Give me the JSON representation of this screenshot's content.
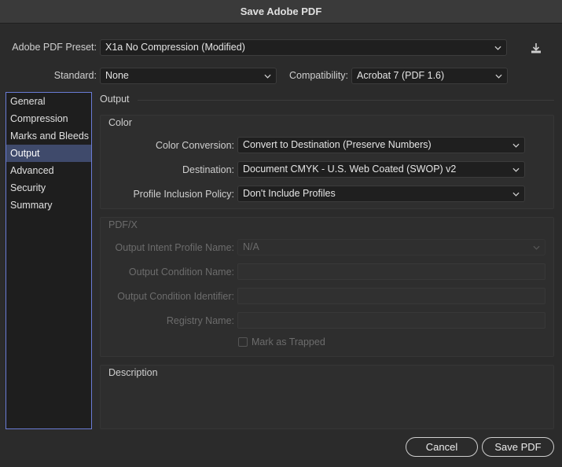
{
  "window": {
    "title": "Save Adobe PDF"
  },
  "preset": {
    "label": "Adobe PDF Preset:",
    "value": "X1a No Compression (Modified)",
    "save_icon": "save-preset-icon"
  },
  "standard": {
    "label": "Standard:",
    "value": "None"
  },
  "compatibility": {
    "label": "Compatibility:",
    "value": "Acrobat 7 (PDF 1.6)"
  },
  "sidebar": {
    "items": [
      {
        "label": "General"
      },
      {
        "label": "Compression"
      },
      {
        "label": "Marks and Bleeds"
      },
      {
        "label": "Output",
        "active": true
      },
      {
        "label": "Advanced"
      },
      {
        "label": "Security"
      },
      {
        "label": "Summary"
      }
    ]
  },
  "panel": {
    "title": "Output",
    "color": {
      "title": "Color",
      "conversion": {
        "label": "Color Conversion:",
        "value": "Convert to Destination (Preserve Numbers)"
      },
      "destination": {
        "label": "Destination:",
        "value": "Document CMYK - U.S. Web Coated (SWOP) v2"
      },
      "profile": {
        "label": "Profile Inclusion Policy:",
        "value": "Don't Include Profiles"
      }
    },
    "pdfx": {
      "title": "PDF/X",
      "intent": {
        "label": "Output Intent Profile Name:",
        "value": "N/A"
      },
      "condition_name": {
        "label": "Output Condition Name:",
        "value": ""
      },
      "condition_id": {
        "label": "Output Condition Identifier:",
        "value": ""
      },
      "registry": {
        "label": "Registry Name:",
        "value": ""
      },
      "trapped": {
        "label": "Mark as Trapped",
        "checked": false
      }
    },
    "description": {
      "title": "Description",
      "text": ""
    }
  },
  "buttons": {
    "cancel": "Cancel",
    "save": "Save PDF"
  },
  "colors": {
    "accent": "#6a7cd6",
    "active_item": "#3f4a6b",
    "background": "#2b2b2b"
  }
}
